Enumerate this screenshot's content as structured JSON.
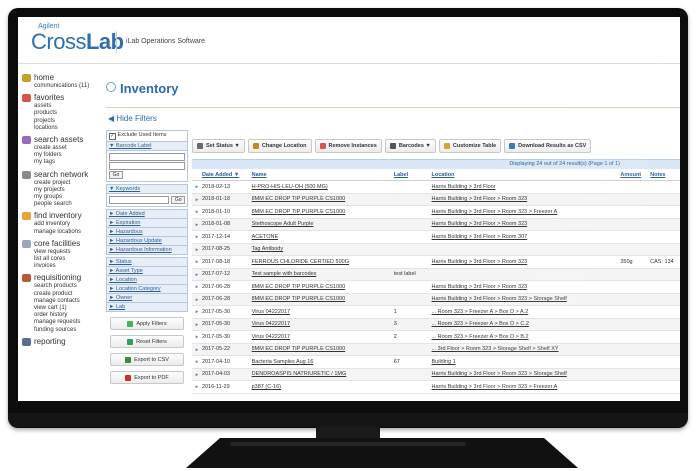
{
  "header": {
    "brand_small": "Agilent",
    "brand_main_a": "Cross",
    "brand_main_b": "Lab",
    "product": "iLab Operations Software"
  },
  "nav": [
    {
      "title": "home",
      "icon_color": "#c8a02a",
      "icon": "home-icon",
      "items": [
        "communications (11)"
      ]
    },
    {
      "title": "favorites",
      "icon_color": "#d9534f",
      "icon": "heart-icon",
      "items": [
        "assets",
        "products",
        "projects",
        "locations"
      ]
    },
    {
      "title": "search assets",
      "icon_color": "#9a6bbd",
      "icon": "search-icon",
      "items": [
        "create asset",
        "my folders",
        "my tags"
      ]
    },
    {
      "title": "search network",
      "icon_color": "#8a8a8a",
      "icon": "network-icon",
      "items": [
        "create project",
        "my projects",
        "my groups",
        "people search"
      ]
    },
    {
      "title": "find inventory",
      "icon_color": "#e8a33a",
      "icon": "inventory-icon",
      "items": [
        "add inventory",
        "manage locations"
      ]
    },
    {
      "title": "core facilities",
      "icon_color": "#9aa7b5",
      "icon": "facility-icon",
      "items": [
        "view requests",
        "list all cores",
        "invoices"
      ]
    },
    {
      "title": "requisitioning",
      "icon_color": "#b85a3a",
      "icon": "requisition-icon",
      "items": [
        "search products",
        "create product",
        "manage contacts",
        "view cart (1)",
        "order history",
        "manage requests",
        "funding sources"
      ]
    },
    {
      "title": "reporting",
      "icon_color": "#5b6f8a",
      "icon": "chart-icon",
      "items": []
    }
  ],
  "page": {
    "title": "Inventory",
    "hide_filters": "Hide Filters"
  },
  "filters": {
    "exclude_used": "Exclude Used Items",
    "barcode_label": "Barcode Label",
    "keywords": "Keywords",
    "go": "Go",
    "group1": [
      "Date Added",
      "Expiration",
      "Hazardous",
      "Hazardous Update",
      "Hazardous Information"
    ],
    "group2": [
      "Status",
      "Asset Type",
      "Location",
      "Location Category",
      "Owner",
      "Lab"
    ],
    "buttons": [
      {
        "label": "Apply Filters",
        "color": "#4caf50"
      },
      {
        "label": "Reset Filters",
        "color": "#3a9a5a"
      },
      {
        "label": "Export to CSV",
        "color": "#3c8a3c"
      },
      {
        "label": "Export to PDF",
        "color": "#c9302c"
      }
    ]
  },
  "toolbar": [
    {
      "label": "Set Status ▼",
      "color": "#6b6b6b"
    },
    {
      "label": "Change Location",
      "color": "#c8862a"
    },
    {
      "label": "Remove Instances",
      "color": "#d9534f"
    },
    {
      "label": "Barcodes ▼",
      "color": "#555555"
    },
    {
      "label": "Customize Table",
      "color": "#d4a63a"
    },
    {
      "label": "Download Results as CSV",
      "color": "#3a7bbd"
    }
  ],
  "table": {
    "status": "Displaying 24 out of 24 result(s) (Page 1 of 1)",
    "columns": [
      "Date Added ▼",
      "Name",
      "Label",
      "Location",
      "Amount",
      "Notes"
    ],
    "rows": [
      {
        "date": "2018-02-13",
        "name": "H-PRO-HIS-LEU-OH (500 MG)",
        "label": "",
        "location": "Harris Building > 3rd Floor",
        "amount": "",
        "notes": ""
      },
      {
        "date": "2018-01-18",
        "name": "8MM EC DROP TIP PURPLE CS1000",
        "label": "",
        "location": "Harris Building > 3rd Floor > Room 323",
        "amount": "",
        "notes": ""
      },
      {
        "date": "2018-01-10",
        "name": "8MM EC DROP TIP PURPLE CS1000",
        "label": "",
        "location": "Harris Building > 3rd Floor > Room 323 > Freezer A",
        "amount": "",
        "notes": ""
      },
      {
        "date": "2018-01-08",
        "name": "Stethoscope Adult Purple",
        "label": "",
        "location": "Harris Building > 3rd Floor > Room 323",
        "amount": "",
        "notes": ""
      },
      {
        "date": "2017-12-14",
        "name": "ACETONE",
        "label": "",
        "location": "Harris Building > 3rd Floor > Room 307",
        "amount": "",
        "notes": ""
      },
      {
        "date": "2017-08-25",
        "name": "Tag Antibody",
        "label": "",
        "location": "",
        "amount": "",
        "notes": ""
      },
      {
        "date": "2017-08-18",
        "name": "FERROUS CHLORIDE CERTIED 500G",
        "label": "",
        "location": "Harris Building > 3rd Floor > Room 323",
        "amount": "350g",
        "notes": "CAS: 134"
      },
      {
        "date": "2017-07-12",
        "name": "Test sample with barcodes",
        "label": "test label",
        "location": "",
        "amount": "",
        "notes": ""
      },
      {
        "date": "2017-06-28",
        "name": "8MM EC DROP TIP PURPLE CS1000",
        "label": "",
        "location": "Harris Building > 3rd Floor > Room 323",
        "amount": "",
        "notes": ""
      },
      {
        "date": "2017-06-28",
        "name": "8MM EC DROP TIP PURPLE CS1000",
        "label": "",
        "location": "Harris Building > 3rd Floor > Room 323 > Storage Shelf",
        "amount": "",
        "notes": ""
      },
      {
        "date": "2017-05-30",
        "name": "Virus 04222017",
        "label": "1",
        "location": "... Room 323 > Freezer A > Box D > A.2",
        "amount": "",
        "notes": ""
      },
      {
        "date": "2017-05-30",
        "name": "Virus 04222017",
        "label": "3",
        "location": "... Room 323 > Freezer A > Box D > C.2",
        "amount": "",
        "notes": ""
      },
      {
        "date": "2017-05-30",
        "name": "Virus 04222017",
        "label": "2",
        "location": "... Room 323 > Freezer A > Box D > B.2",
        "amount": "",
        "notes": ""
      },
      {
        "date": "2017-05-22",
        "name": "8MM EC DROP TIP PURPLE CS1000",
        "label": "",
        "location": "... 3rd Floor > Room 323 > Storage Shelf > Shelf XY",
        "amount": "",
        "notes": ""
      },
      {
        "date": "2017-04-10",
        "name": "Bacteria Samples Aug 16",
        "label": "67",
        "location": "Building 1",
        "amount": "",
        "notes": ""
      },
      {
        "date": "2017-04-03",
        "name": "DENDROASPIS NATRIURETIC / 1MG",
        "label": "",
        "location": "Harris Building > 3rd Floor > Room 323 > Storage Shelf",
        "amount": "",
        "notes": ""
      },
      {
        "date": "2016-11-29",
        "name": "p387 (C-16)",
        "label": "",
        "location": "Harris Building > 3rd Floor > Room 323 > Freezer A",
        "amount": "",
        "notes": ""
      }
    ]
  }
}
